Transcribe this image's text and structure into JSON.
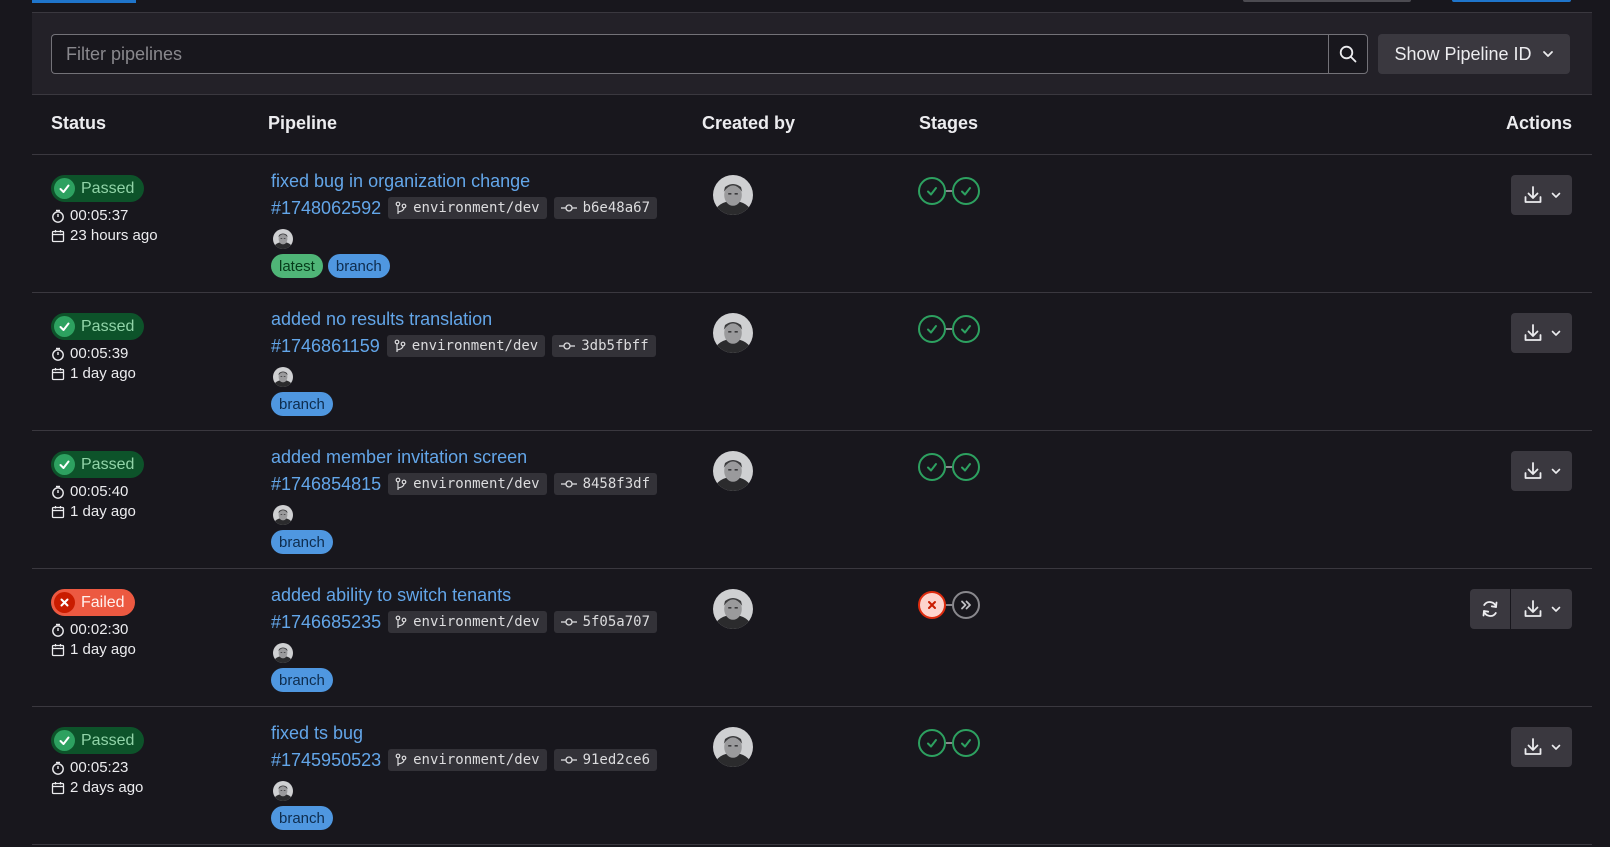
{
  "filter": {
    "placeholder": "Filter pipelines",
    "show_id_label": "Show Pipeline ID"
  },
  "columns": {
    "status": "Status",
    "pipeline": "Pipeline",
    "created_by": "Created by",
    "stages": "Stages",
    "actions": "Actions"
  },
  "colors": {
    "passed": "#2da160",
    "failed": "#dd2b0e",
    "link": "#63a6e9",
    "skipped": "#89888d"
  },
  "pipelines": [
    {
      "status": "Passed",
      "duration": "00:05:37",
      "created": "23 hours ago",
      "title": "fixed bug in organization change",
      "id": "#1748062592",
      "ref": "environment/dev",
      "sha": "b6e48a67",
      "labels": [
        "latest",
        "branch"
      ],
      "stages": [
        "success",
        "success"
      ],
      "has_retry": false
    },
    {
      "status": "Passed",
      "duration": "00:05:39",
      "created": "1 day ago",
      "title": "added no results translation",
      "id": "#1746861159",
      "ref": "environment/dev",
      "sha": "3db5fbff",
      "labels": [
        "branch"
      ],
      "stages": [
        "success",
        "success"
      ],
      "has_retry": false
    },
    {
      "status": "Passed",
      "duration": "00:05:40",
      "created": "1 day ago",
      "title": "added member invitation screen",
      "id": "#1746854815",
      "ref": "environment/dev",
      "sha": "8458f3df",
      "labels": [
        "branch"
      ],
      "stages": [
        "success",
        "success"
      ],
      "has_retry": false
    },
    {
      "status": "Failed",
      "duration": "00:02:30",
      "created": "1 day ago",
      "title": "added ability to switch tenants",
      "id": "#1746685235",
      "ref": "environment/dev",
      "sha": "5f05a707",
      "labels": [
        "branch"
      ],
      "stages": [
        "failed",
        "skipped"
      ],
      "has_retry": true
    },
    {
      "status": "Passed",
      "duration": "00:05:23",
      "created": "2 days ago",
      "title": "fixed ts bug",
      "id": "#1745950523",
      "ref": "environment/dev",
      "sha": "91ed2ce6",
      "labels": [
        "branch"
      ],
      "stages": [
        "success",
        "success"
      ],
      "has_retry": false
    }
  ]
}
